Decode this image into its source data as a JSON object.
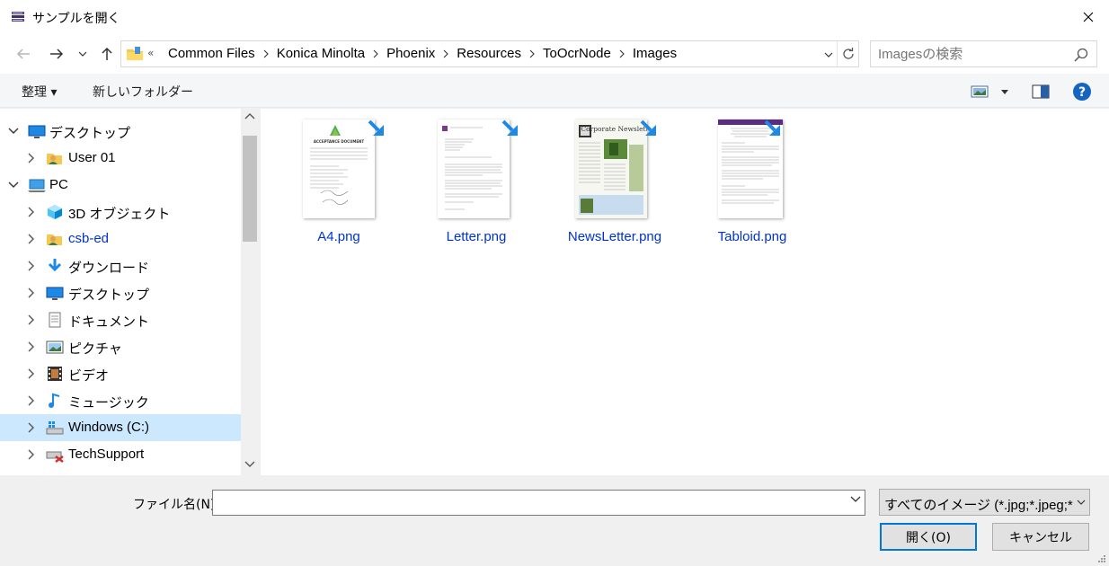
{
  "window": {
    "title": "サンプルを開く",
    "app_icon": "stacked-books-icon",
    "close_icon": "close-icon"
  },
  "navigation": {
    "back_icon": "back-arrow-icon",
    "forward_icon": "forward-arrow-icon",
    "recent_icon": "chevron-down-icon",
    "up_icon": "up-arrow-icon"
  },
  "address": {
    "overflow": "«",
    "crumbs": [
      "Common Files",
      "Konica Minolta",
      "Phoenix",
      "Resources",
      "ToOcrNode",
      "Images"
    ],
    "refresh_icon": "refresh-icon"
  },
  "search": {
    "placeholder": "Imagesの検索"
  },
  "toolbar": {
    "organize": "整理 ▾",
    "new_folder": "新しいフォルダー",
    "view_icon": "view-options-icon",
    "preview_pane_icon": "preview-pane-icon",
    "help_icon": "help-icon"
  },
  "tree": [
    {
      "label": "デスクトップ",
      "icon": "desktop-icon",
      "expanded": true
    },
    {
      "label": "User 01",
      "icon": "user-folder-icon",
      "expanded": false
    },
    {
      "label": "PC",
      "icon": "pc-icon",
      "expanded": true
    },
    {
      "label": "3D オブジェクト",
      "icon": "3d-objects-icon",
      "expanded": false
    },
    {
      "label": "csb-ed",
      "icon": "user-folder-icon",
      "expanded": false
    },
    {
      "label": "ダウンロード",
      "icon": "download-icon",
      "expanded": false
    },
    {
      "label": "デスクトップ",
      "icon": "desktop-icon",
      "expanded": false
    },
    {
      "label": "ドキュメント",
      "icon": "documents-icon",
      "expanded": false
    },
    {
      "label": "ピクチャ",
      "icon": "pictures-icon",
      "expanded": false
    },
    {
      "label": "ビデオ",
      "icon": "videos-icon",
      "expanded": false
    },
    {
      "label": "ミュージック",
      "icon": "music-icon",
      "expanded": false
    },
    {
      "label": "Windows (C:)",
      "icon": "drive-icon",
      "expanded": false,
      "selected": true
    },
    {
      "label": "TechSupport",
      "icon": "network-drive-disconnected-icon",
      "expanded": false
    }
  ],
  "files": [
    {
      "name": "A4.png",
      "thumbnail": "acceptance-document",
      "heading": "ACCEPTANCE DOCUMENT"
    },
    {
      "name": "Letter.png",
      "thumbnail": "letter-document"
    },
    {
      "name": "NewsLetter.png",
      "thumbnail": "newsletter-document",
      "heading": "Corporate Newsletter"
    },
    {
      "name": "Tabloid.png",
      "thumbnail": "tabloid-document"
    }
  ],
  "bottom": {
    "filename_label": "ファイル名(N):",
    "filename_value": "",
    "filter_value": "すべてのイメージ (*.jpg;*.jpeg;*.png",
    "open_label": "開く(O)",
    "cancel_label": "キャンセル"
  },
  "colors": {
    "file_name": "#0033cc",
    "selected_row": "#cce8ff",
    "accent": "#0078d7"
  }
}
